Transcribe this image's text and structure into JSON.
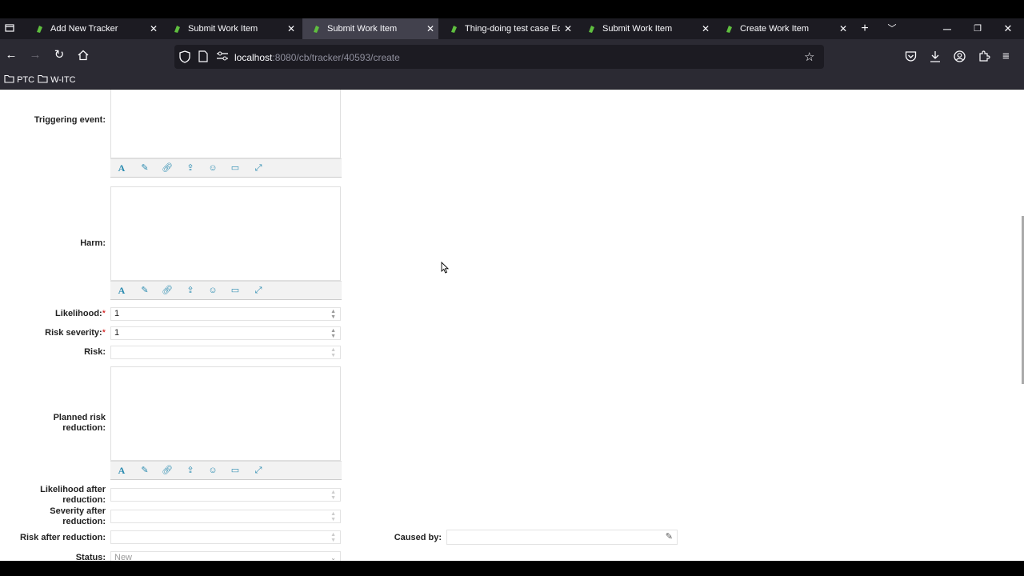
{
  "tabs": [
    {
      "title": "Add New Tracker",
      "active": false
    },
    {
      "title": "Submit Work Item",
      "active": false
    },
    {
      "title": "Submit Work Item",
      "active": true
    },
    {
      "title": "Thing-doing test case Edit",
      "active": false
    },
    {
      "title": "Submit Work Item",
      "active": false
    },
    {
      "title": "Create Work Item",
      "active": false
    }
  ],
  "address": {
    "host": "localhost",
    "path": ":8080/cb/tracker/40593/create"
  },
  "bookmarks": [
    "PTC",
    "W-ITC"
  ],
  "form": {
    "triggering_event_label": "Triggering event:",
    "harm_label": "Harm:",
    "likelihood_label": "Likelihood:",
    "likelihood_value": "1",
    "risk_severity_label": "Risk severity:",
    "risk_severity_value": "1",
    "required_mark": "*",
    "risk_label": "Risk:",
    "risk_value": "",
    "planned_risk_reduction_label_1": "Planned risk",
    "planned_risk_reduction_label_2": "reduction:",
    "likelihood_after_label_1": "Likelihood after",
    "likelihood_after_label_2": "reduction:",
    "severity_after_label_1": "Severity after",
    "severity_after_label_2": "reduction:",
    "risk_after_label": "Risk after reduction:",
    "caused_by_label": "Caused by:",
    "status_label": "Status:",
    "status_value": "New"
  },
  "colors": {
    "accent": "#2a8bb0",
    "tabbar": "#1c1b22",
    "navbar": "#2b2a33",
    "active_tab": "#42414d"
  }
}
